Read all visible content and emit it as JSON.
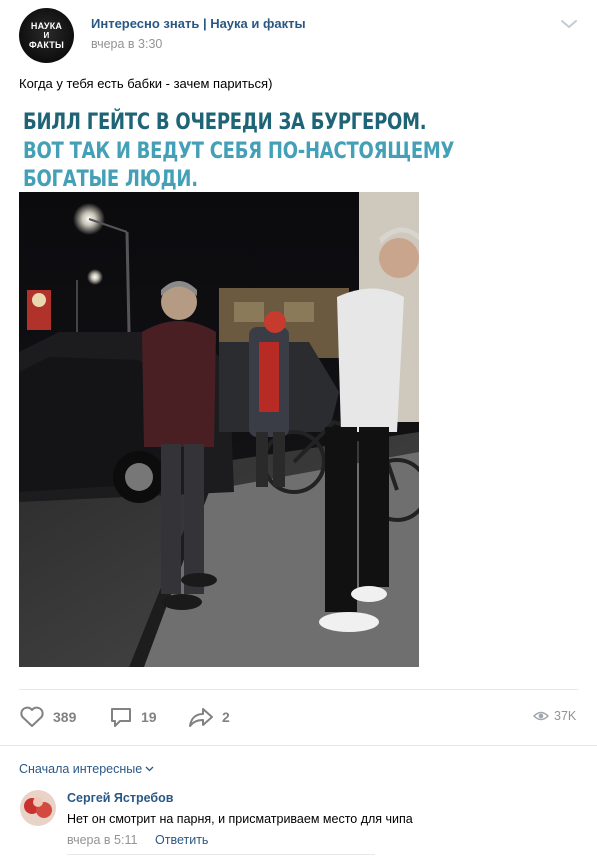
{
  "post": {
    "group_name": "Интересно знать | Наука и факты",
    "time": "вчера в 3:30",
    "avatar_lines": [
      "НАУКА",
      "И",
      "ФАКТЫ"
    ],
    "text": "Когда у тебя есть бабки - зачем париться)",
    "banner": {
      "line1": "БИЛЛ ГЕЙТС В ОЧЕРЕДИ ЗА БУРГЕРОМ.",
      "line2": "ВОТ ТАК И ВЕДУТ СЕБЯ ПО-НАСТОЯЩЕМУ",
      "line3": "БОГАТЫЕ ЛЮДИ.",
      "colors": {
        "line1": "#1e6476",
        "line2": "#43a0b6"
      }
    }
  },
  "actions": {
    "likes": "389",
    "comments": "19",
    "shares": "2",
    "views": "37K"
  },
  "comments": {
    "sort_label": "Сначала интересные",
    "items": [
      {
        "author": "Сергей Ястребов",
        "text": "Нет он смотрит на парня, и присматриваем место для чипа",
        "time": "вчера в 5:11",
        "reply_label": "Ответить"
      }
    ]
  },
  "icons": {
    "like": "heart-icon",
    "comment": "comment-bubble-icon",
    "share": "share-arrow-icon",
    "views": "eye-icon",
    "menu": "chevron-down-icon"
  },
  "colors": {
    "link": "#2a5885",
    "muted": "#939393",
    "icon": "#828282"
  }
}
